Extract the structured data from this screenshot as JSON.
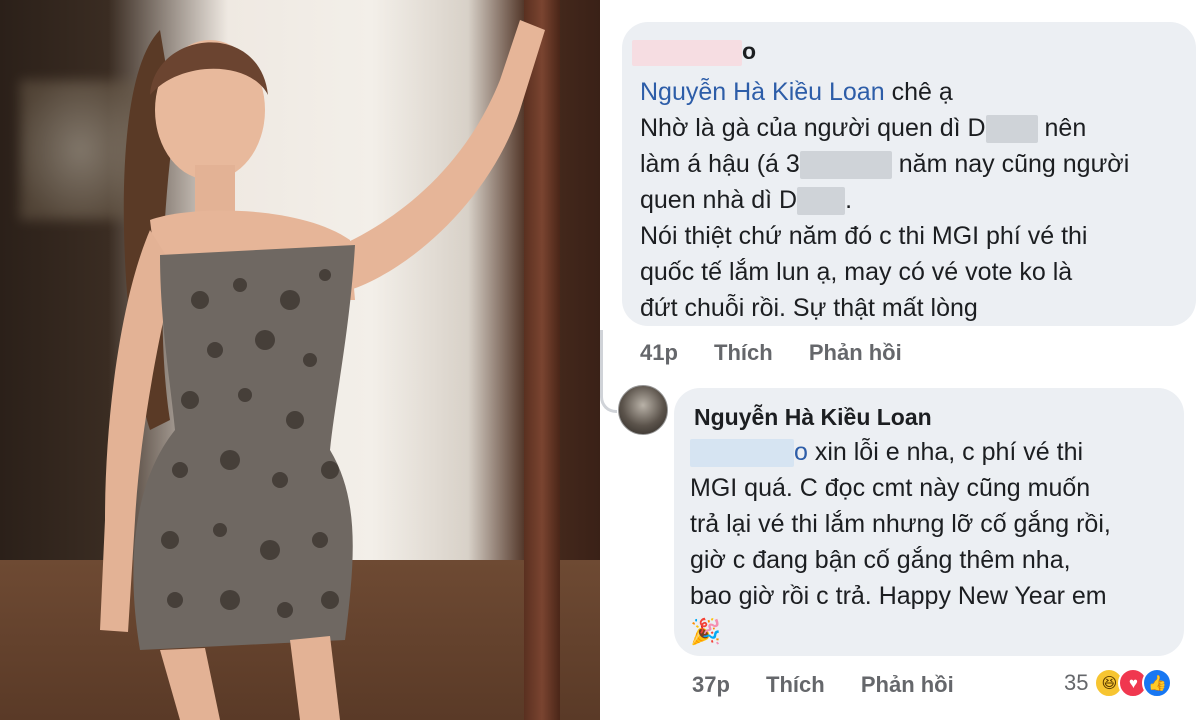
{
  "comment1": {
    "author_visible": "o",
    "mention": "Nguyễn Hà Kiều Loan",
    "line1_suffix": " chê ạ",
    "line2_a": "Nhờ là gà của người quen dì D",
    "line2_b": " nên",
    "line3_a": "làm á hậu (á 3",
    "line3_b": " năm nay cũng người",
    "line4_a": "quen nhà dì D",
    "line4_b": ".",
    "line5": "Nói thiệt chứ năm đó c thi MGI phí vé thi",
    "line6": "quốc tế lắm lun ạ, may có vé vote ko là",
    "line7": "đứt chuỗi rồi. Sự thật mất lòng",
    "time": "41p",
    "like": "Thích",
    "reply": "Phản hồi"
  },
  "comment2": {
    "author": "Nguyễn Hà Kiều Loan",
    "line1_mention_tail": "o",
    "line1_rest": " xin lỗi e nha, c phí vé thi",
    "line2": "MGI quá. C đọc cmt này cũng muốn",
    "line3": "trả lại vé thi lắm nhưng lỡ cố gắng rồi,",
    "line4": "giờ c đang bận cố gắng thêm nha,",
    "line5": "bao giờ rồi c trả. Happy New Year em",
    "emoji": "🎉",
    "time": "37p",
    "like": "Thích",
    "reply": "Phản hồi",
    "reaction_count": "35"
  },
  "colors": {
    "bubble": "#eceff3",
    "mention": "#2d5da8",
    "meta": "#65676b"
  }
}
